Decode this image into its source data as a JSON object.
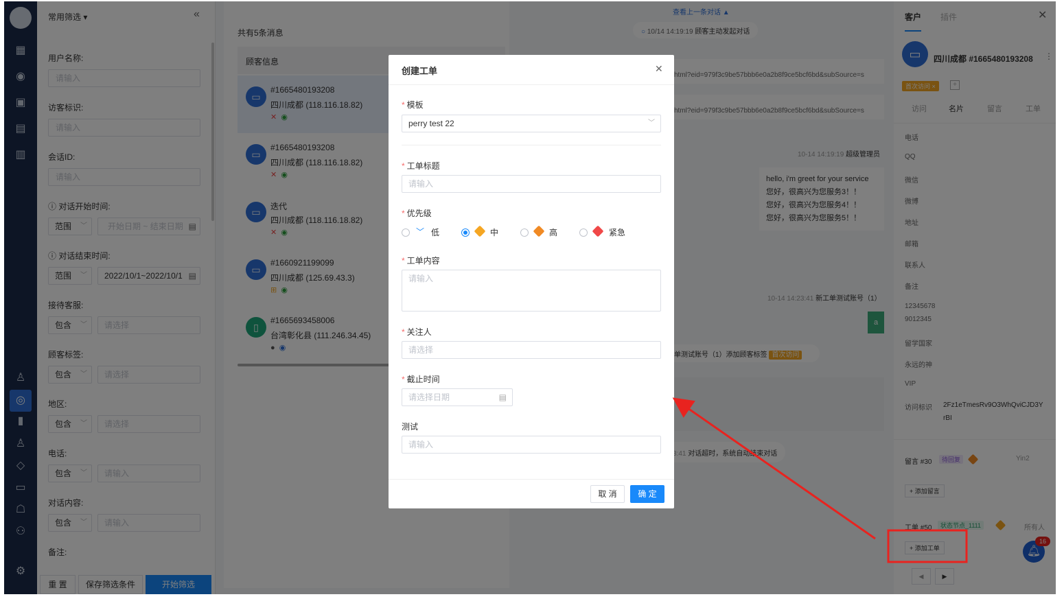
{
  "filter": {
    "header": "常用筛选",
    "fields": [
      {
        "label": "用户名称:",
        "placeholder": "请输入"
      },
      {
        "label": "访客标识:",
        "placeholder": "请输入"
      },
      {
        "label": "会话ID:",
        "placeholder": "请输入"
      }
    ],
    "start_time": {
      "label": "对话开始时间:",
      "mode": "范围",
      "start": "开始日期",
      "sep": "~",
      "end": "结束日期"
    },
    "end_time": {
      "label": "对话结束时间:",
      "mode": "范围",
      "value": "2022/10/1~2022/10/1"
    },
    "selects": [
      {
        "label": "接待客服:",
        "mode": "包含",
        "placeholder": "请选择"
      },
      {
        "label": "顾客标签:",
        "mode": "包含",
        "placeholder": "请选择"
      },
      {
        "label": "地区:",
        "mode": "包含",
        "placeholder": "请选择"
      },
      {
        "label": "电话:",
        "mode": "包含",
        "placeholder": "请输入"
      },
      {
        "label": "对话内容:",
        "mode": "包含",
        "placeholder": "请输入"
      }
    ],
    "note_label": "备注:",
    "btn_reset": "重 置",
    "btn_save": "保存筛选条件",
    "btn_start": "开始筛选"
  },
  "list": {
    "count": "共有5条消息",
    "header": "顾客信息",
    "items": [
      {
        "id": "#1665480193208",
        "loc": "四川成都 (118.116.18.82)"
      },
      {
        "id": "#1665480193208",
        "loc": "四川成都 (118.116.18.82)"
      },
      {
        "id": "迭代",
        "loc": "四川成都 (118.116.18.82)"
      },
      {
        "id": "#1660921199099",
        "loc": "四川成都 (125.69.43.3)"
      },
      {
        "id": "#1665693458006",
        "loc": "台湾彰化县 (111.246.34.45)"
      }
    ]
  },
  "chat": {
    "prev": "查看上一条对话 ▲",
    "start_time": "10/14 14:19:19",
    "start_text": "顾客主动发起对话",
    "url1": "html?eid=979f3c9be57bbb6e0a2b8f9ce5bcf6bd&subSource=s",
    "url2": "html?eid=979f3c9be57bbb6e0a2b8f9ce5bcf6bd&subSource=s",
    "agent_time": "10-14 14:19:19",
    "agent_name": "超级管理员",
    "greet_lines": [
      "hello, i'm greet for your service",
      "您好，很高兴为您服务3！！",
      "您好，很高兴为您服务4！！",
      "您好，很高兴为您服务5！！"
    ],
    "msg2_time": "10-14 14:23:41",
    "msg2_name": "新工单测试账号（1）",
    "bubble_a": "a",
    "tag_event": "单测试账号（1）添加顾客标签",
    "tag_badge": "首次访问",
    "timeout_time": "3:41",
    "timeout_text": "对话超时，系统自动结束对话"
  },
  "right": {
    "tab_customer": "客户",
    "tab_plugin": "插件",
    "name": "四川成都 #1665480193208",
    "tag": "首次访问",
    "subtabs": [
      "访问",
      "名片",
      "留言",
      "工单"
    ],
    "fields": [
      "电话",
      "QQ",
      "微信",
      "微博",
      "地址",
      "邮箱",
      "联系人",
      "备注"
    ],
    "note_value1": "12345678",
    "note_value2": "9012345",
    "field_study": "留学国家",
    "field_god": "永远的神",
    "field_vip": "VIP",
    "visit_label": "访问标识",
    "visit_value1": "2Fz1eTmesRv9O3WhQviCJD3Y",
    "visit_value2": "rBI",
    "leave_title": "留言 #30",
    "leave_status": "待回复",
    "leave_user": "Yin2",
    "add_leave": "+ 添加留言",
    "ticket_title": "工单 #50",
    "ticket_status": "状态节点_1111",
    "ticket_owner": "所有人",
    "add_ticket": "+ 添加工单",
    "bell_count": "16"
  },
  "modal": {
    "title": "创建工单",
    "template_label": "模板",
    "template_value": "perry test 22",
    "title_label": "工单标题",
    "title_placeholder": "请输入",
    "priority_label": "优先级",
    "priorities": [
      {
        "label": "低",
        "color": "#1989fa"
      },
      {
        "label": "中",
        "color": "#f5a623"
      },
      {
        "label": "高",
        "color": "#f08a24"
      },
      {
        "label": "紧急",
        "color": "#f04848"
      }
    ],
    "content_label": "工单内容",
    "content_placeholder": "请输入",
    "follower_label": "关注人",
    "follower_placeholder": "请选择",
    "deadline_label": "截止时间",
    "deadline_placeholder": "请选择日期",
    "test_label": "测试",
    "test_placeholder": "请输入",
    "cancel": "取 消",
    "confirm": "确 定"
  },
  "colors": {
    "accent": "#1989fa",
    "highlight": "#e8231f"
  }
}
